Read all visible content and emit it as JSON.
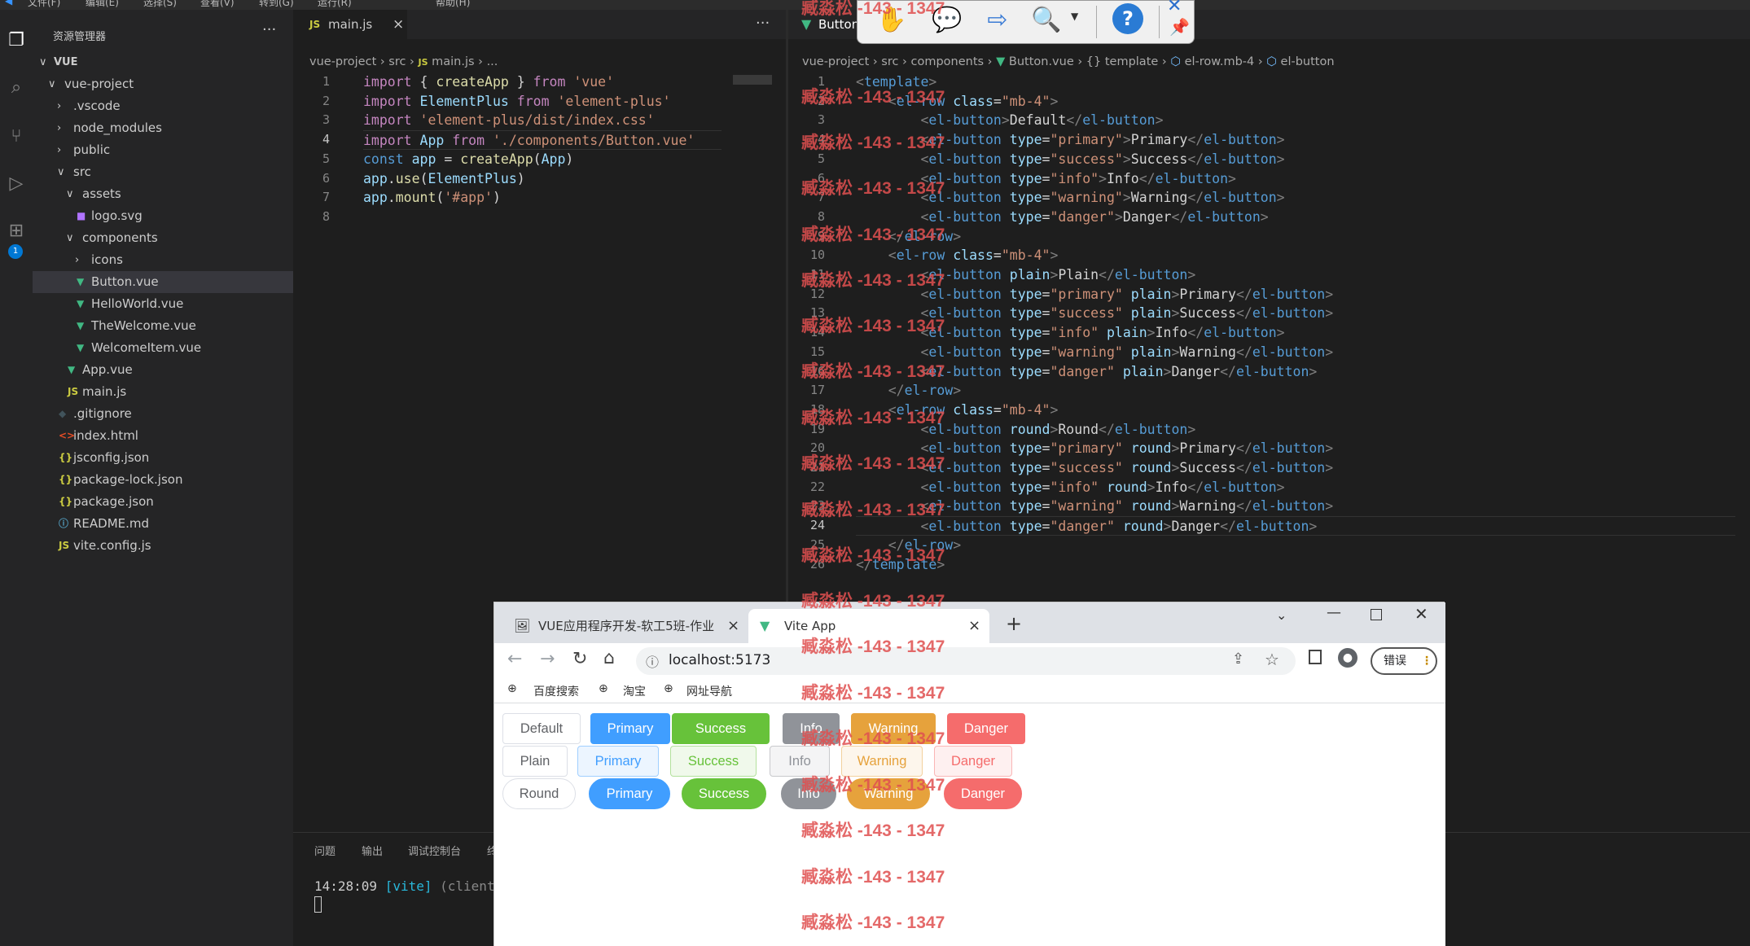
{
  "menubar": {
    "items": [
      "文件(F)",
      "编辑(E)",
      "选择(S)",
      "查看(V)",
      "转到(G)",
      "运行(R)",
      "帮助(H)"
    ]
  },
  "sidebar": {
    "title": "资源管理器",
    "more_label": "···",
    "workspace": "VUE",
    "tree": [
      {
        "label": "vue-project",
        "type": "folder-open",
        "icon": ""
      },
      {
        "label": ".vscode",
        "type": "folder",
        "icon": ""
      },
      {
        "label": "node_modules",
        "type": "folder",
        "icon": ""
      },
      {
        "label": "public",
        "type": "folder",
        "icon": ""
      },
      {
        "label": "src",
        "type": "folder-open",
        "icon": ""
      },
      {
        "label": "assets",
        "type": "folder-open",
        "icon": ""
      },
      {
        "label": "logo.svg",
        "type": "file",
        "icon": "svg-icon"
      },
      {
        "label": "components",
        "type": "folder-open",
        "icon": ""
      },
      {
        "label": "icons",
        "type": "folder",
        "icon": ""
      },
      {
        "label": "Button.vue",
        "type": "file",
        "icon": "vue-icon"
      },
      {
        "label": "HelloWorld.vue",
        "type": "file",
        "icon": "vue-icon"
      },
      {
        "label": "TheWelcome.vue",
        "type": "file",
        "icon": "vue-icon"
      },
      {
        "label": "WelcomeItem.vue",
        "type": "file",
        "icon": "vue-icon"
      },
      {
        "label": "App.vue",
        "type": "file",
        "icon": "vue-icon"
      },
      {
        "label": "main.js",
        "type": "file",
        "icon": "js-icon"
      },
      {
        "label": ".gitignore",
        "type": "file",
        "icon": "git-icon"
      },
      {
        "label": "index.html",
        "type": "file",
        "icon": "html-icon"
      },
      {
        "label": "jsconfig.json",
        "type": "file",
        "icon": "json-icon"
      },
      {
        "label": "package-lock.json",
        "type": "file",
        "icon": "json-icon"
      },
      {
        "label": "package.json",
        "type": "file",
        "icon": "json-icon"
      },
      {
        "label": "README.md",
        "type": "file",
        "icon": "info-icon"
      },
      {
        "label": "vite.config.js",
        "type": "file",
        "icon": "js-icon"
      }
    ]
  },
  "editor1": {
    "tab_icon": "JS",
    "tab_label": "main.js",
    "tab_close": "×",
    "more_label": "···",
    "breadcrumb": [
      "vue-project",
      "src",
      "JS",
      "main.js",
      "..."
    ],
    "lines": [
      "import { createApp } from 'vue'",
      "import ElementPlus from 'element-plus'",
      "import 'element-plus/dist/index.css'",
      "import App from './components/Button.vue'",
      "const app = createApp(App)",
      "app.use(ElementPlus)",
      "app.mount('#app')",
      ""
    ],
    "line_numbers": [
      "1",
      "2",
      "3",
      "4",
      "5",
      "6",
      "7",
      "8"
    ],
    "current_line": 4
  },
  "editor2": {
    "tab_label": "Button",
    "breadcrumb": [
      "vue-project",
      "src",
      "components",
      "Button.vue",
      "{} template",
      "el-row.mb-4",
      "el-button"
    ],
    "line_numbers": [
      "1",
      "2",
      "3",
      "4",
      "5",
      "6",
      "7",
      "8",
      "9",
      "10",
      "11",
      "12",
      "13",
      "14",
      "15",
      "16",
      "17",
      "18",
      "19",
      "20",
      "21",
      "22",
      "23",
      "24",
      "25",
      "26"
    ],
    "current_line": 24,
    "lines": [
      "<template>",
      "    <el-row class=\"mb-4\">",
      "        <el-button>Default</el-button>",
      "        <el-button type=\"primary\">Primary</el-button>",
      "        <el-button type=\"success\">Success</el-button>",
      "        <el-button type=\"info\">Info</el-button>",
      "        <el-button type=\"warning\">Warning</el-button>",
      "        <el-button type=\"danger\">Danger</el-button>",
      "    </el-row>",
      "    <el-row class=\"mb-4\">",
      "        <el-button plain>Plain</el-button>",
      "        <el-button type=\"primary\" plain>Primary</el-button>",
      "        <el-button type=\"success\" plain>Success</el-button>",
      "        <el-button type=\"info\" plain>Info</el-button>",
      "        <el-button type=\"warning\" plain>Warning</el-button>",
      "        <el-button type=\"danger\" plain>Danger</el-button>",
      "    </el-row>",
      "    <el-row class=\"mb-4\">",
      "        <el-button round>Round</el-button>",
      "        <el-button type=\"primary\" round>Primary</el-button>",
      "        <el-button type=\"success\" round>Success</el-button>",
      "        <el-button type=\"info\" round>Info</el-button>",
      "        <el-button type=\"warning\" round>Warning</el-button>",
      "        <el-button type=\"danger\" round>Danger</el-button>",
      "    </el-row>",
      "</template>"
    ]
  },
  "watermark": {
    "text": "臧淼松 -143 - 1347"
  },
  "panel": {
    "tabs": [
      "问题",
      "输出",
      "调试控制台",
      "终"
    ],
    "terminal_time": "14:28:09",
    "terminal_tag": "[vite]",
    "terminal_rest": "(client)"
  },
  "browser": {
    "tabs": [
      {
        "label": "VUE应用程序开发-软工5班-作业",
        "close": "×"
      },
      {
        "label": "Vite App",
        "close": "×"
      }
    ],
    "new_tab": "+",
    "url": "localhost:5173",
    "error_label": "错误",
    "bookmarks": [
      "百度搜索",
      "淘宝",
      "网址导航"
    ],
    "rows": [
      {
        "style": "default",
        "buttons": [
          "Default",
          "Primary",
          "Success",
          "Info",
          "Warning",
          "Danger"
        ]
      },
      {
        "style": "plain",
        "buttons": [
          "Plain",
          "Primary",
          "Success",
          "Info",
          "Warning",
          "Danger"
        ]
      },
      {
        "style": "round",
        "buttons": [
          "Round",
          "Primary",
          "Success",
          "Info",
          "Warning",
          "Danger"
        ]
      }
    ]
  },
  "colors": {
    "primary": "#409eff",
    "success": "#67c23a",
    "info": "#909399",
    "warning": "#e6a23c",
    "danger": "#f56c6c"
  }
}
